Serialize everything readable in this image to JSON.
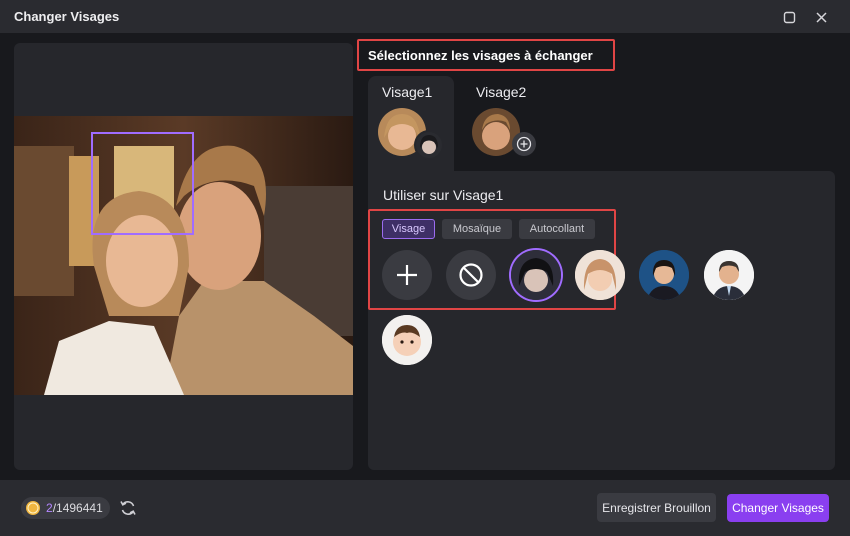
{
  "window": {
    "title": "Changer Visages"
  },
  "heading": "Sélectionnez les visages à échanger",
  "tabs": [
    {
      "label": "Visage1",
      "active": true
    },
    {
      "label": "Visage2",
      "active": false
    }
  ],
  "use_on_label": "Utiliser sur Visage1",
  "mode_chips": [
    {
      "label": "Visage",
      "active": true
    },
    {
      "label": "Mosaïque",
      "active": false
    },
    {
      "label": "Autocollant",
      "active": false
    }
  ],
  "footer": {
    "credits_used": "2",
    "credits_total": "/1496441",
    "save_draft_label": "Enregistrer Brouillon",
    "swap_label": "Changer Visages"
  },
  "colors": {
    "accent": "#8a3ff0",
    "highlight": "#e04545",
    "face_box": "#a06cff"
  }
}
